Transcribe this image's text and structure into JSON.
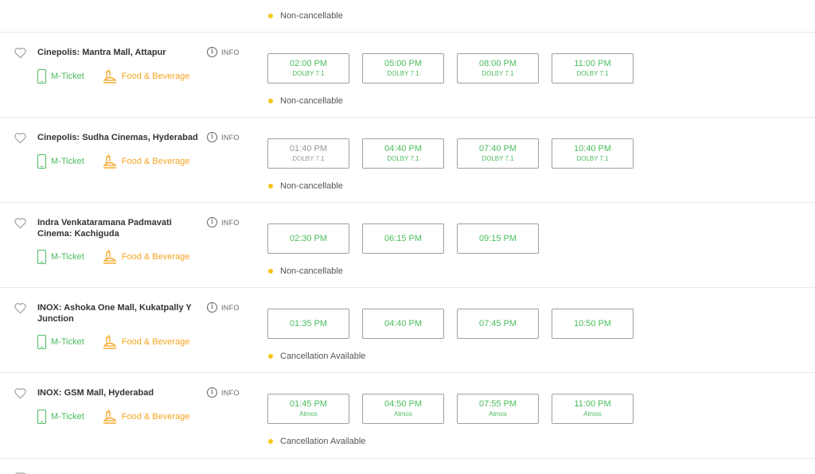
{
  "top": {
    "cancellation": "Non-cancellable"
  },
  "venues": [
    {
      "name": "Cinepolis: Mantra Mall, Attapur",
      "info": "INFO",
      "mticket": "M-Ticket",
      "fnb": "Food & Beverage",
      "shows": [
        {
          "time": "02:00 PM",
          "format": "DOLBY 7.1"
        },
        {
          "time": "05:00 PM",
          "format": "DOLBY 7.1"
        },
        {
          "time": "08:00 PM",
          "format": "DOLBY 7.1"
        },
        {
          "time": "11:00 PM",
          "format": "DOLBY 7.1"
        }
      ],
      "cancellation": "Non-cancellable"
    },
    {
      "name": "Cinepolis: Sudha Cinemas, Hyderabad",
      "info": "INFO",
      "mticket": "M-Ticket",
      "fnb": "Food & Beverage",
      "shows": [
        {
          "time": "01:40 PM",
          "format": "DOLBY 7.1",
          "status": "unavailable"
        },
        {
          "time": "04:40 PM",
          "format": "DOLBY 7.1"
        },
        {
          "time": "07:40 PM",
          "format": "DOLBY 7.1"
        },
        {
          "time": "10:40 PM",
          "format": "DOLBY 7.1"
        }
      ],
      "cancellation": "Non-cancellable"
    },
    {
      "name": "Indra Venkataramana Padmavati Cinema: Kachiguda",
      "info": "INFO",
      "mticket": "M-Ticket",
      "fnb": "Food & Beverage",
      "shows": [
        {
          "time": "02:30 PM"
        },
        {
          "time": "06:15 PM"
        },
        {
          "time": "09:15 PM"
        }
      ],
      "cancellation": "Non-cancellable"
    },
    {
      "name": "INOX: Ashoka One Mall, Kukatpally Y Junction",
      "info": "INFO",
      "mticket": "M-Ticket",
      "fnb": "Food & Beverage",
      "shows": [
        {
          "time": "01:35 PM"
        },
        {
          "time": "04:40 PM"
        },
        {
          "time": "07:45 PM"
        },
        {
          "time": "10:50 PM"
        }
      ],
      "cancellation": "Cancellation Available"
    },
    {
      "name": "INOX: GSM Mall, Hyderabad",
      "info": "INFO",
      "mticket": "M-Ticket",
      "fnb": "Food & Beverage",
      "shows": [
        {
          "time": "01:45 PM",
          "format": "Atmos"
        },
        {
          "time": "04:50 PM",
          "format": "Atmos"
        },
        {
          "time": "07:55 PM",
          "format": "Atmos"
        },
        {
          "time": "11:00 PM",
          "format": "Atmos"
        }
      ],
      "cancellation": "Cancellation Available"
    }
  ],
  "colors": {
    "available": "#4abd5d",
    "fnb": "#f5a623",
    "dot": "#f5c518",
    "unavailable": "#999999"
  }
}
